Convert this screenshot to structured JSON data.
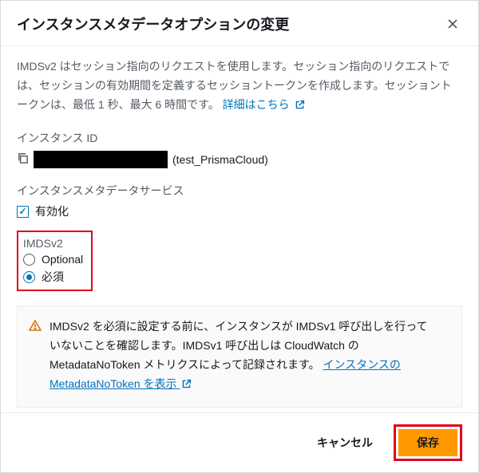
{
  "header": {
    "title": "インスタンスメタデータオプションの変更"
  },
  "description": {
    "text": "IMDSv2 はセッション指向のリクエストを使用します。セッション指向のリクエストでは、セッションの有効期間を定義するセッショントークンを作成します。セッショントークンは、最低 1 秒、最大 6 時間です。",
    "link_label": "詳細はこちら"
  },
  "instance_id": {
    "label": "インスタンス ID",
    "name_suffix": "(test_PrismaCloud)"
  },
  "metadata_service": {
    "label": "インスタンスメタデータサービス",
    "enabled_label": "有効化",
    "enabled": true
  },
  "imdsv2": {
    "label": "IMDSv2",
    "options": [
      {
        "label": "Optional",
        "selected": false
      },
      {
        "label": "必須",
        "selected": true
      }
    ]
  },
  "alert": {
    "text": "IMDSv2 を必須に設定する前に、インスタンスが IMDSv1 呼び出しを行っていないことを確認します。IMDSv1 呼び出しは CloudWatch の MetadataNoToken メトリクスによって記録されます。",
    "link_label": "インスタンスの MetadataNoToken を表示"
  },
  "footer": {
    "cancel": "キャンセル",
    "save": "保存"
  },
  "colors": {
    "link": "#0073bb",
    "primary_button": "#ff9900",
    "highlight_border": "#e3001b"
  }
}
